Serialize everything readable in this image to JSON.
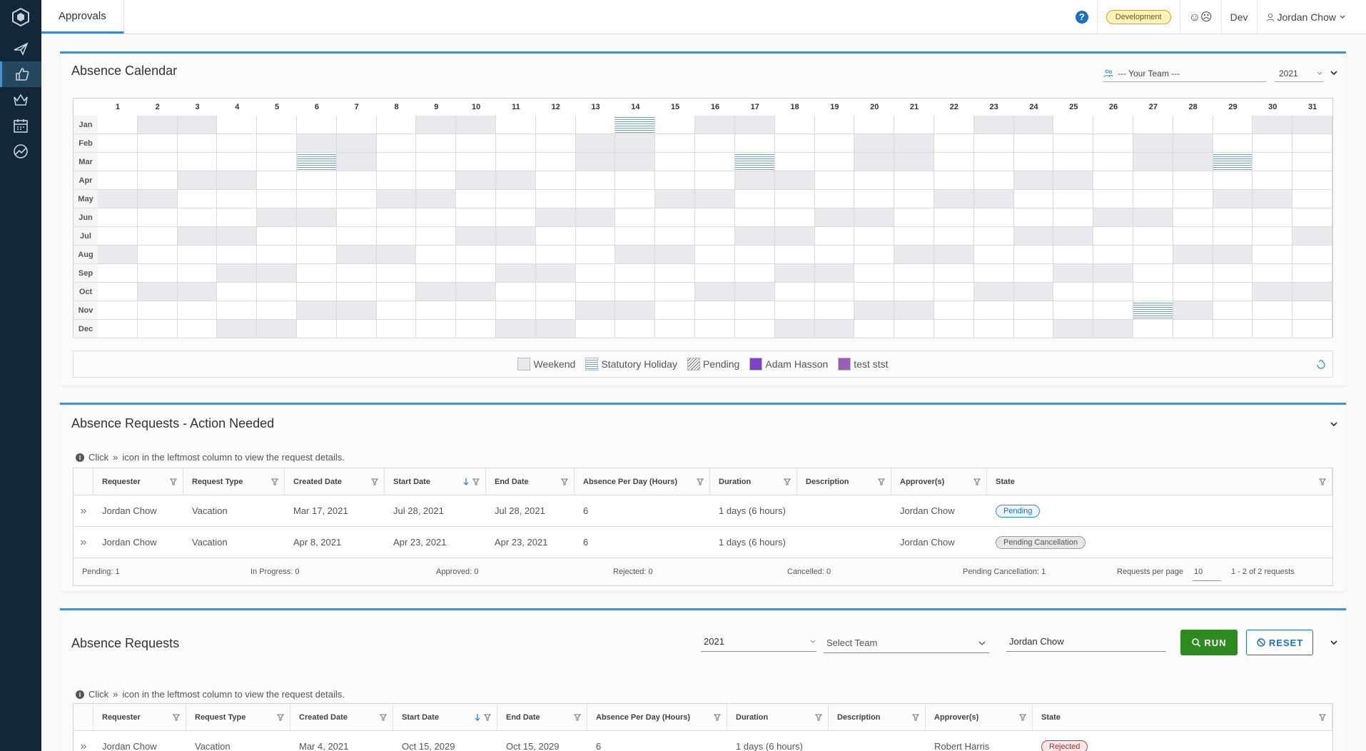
{
  "header": {
    "tab": "Approvals",
    "env_badge": "Development",
    "mood_icons": "☺☹",
    "env_short": "Dev",
    "user": "Jordan Chow"
  },
  "sidebar": {
    "items": [
      "logo-icon",
      "plane-icon",
      "thumbs-up-icon",
      "crown-icon",
      "calendar-icon",
      "chart-icon"
    ]
  },
  "calendar": {
    "title": "Absence Calendar",
    "team_select": "--- Your Team ---",
    "year_select": "2021",
    "days": [
      "1",
      "2",
      "3",
      "4",
      "5",
      "6",
      "7",
      "8",
      "9",
      "10",
      "11",
      "12",
      "13",
      "14",
      "15",
      "16",
      "17",
      "18",
      "19",
      "20",
      "21",
      "22",
      "23",
      "24",
      "25",
      "26",
      "27",
      "28",
      "29",
      "30",
      "31"
    ],
    "months": [
      "Jan",
      "Feb",
      "Mar",
      "Apr",
      "May",
      "Jun",
      "Jul",
      "Aug",
      "Sep",
      "Oct",
      "Nov",
      "Dec"
    ],
    "legend": {
      "weekend": "Weekend",
      "holiday": "Statutory Holiday",
      "pending": "Pending",
      "person1": "Adam Hasson",
      "person2": "test stst"
    },
    "colors": {
      "weekend": "#e9eaed",
      "holiday": "#6f9fd0",
      "person1": "#7a44c4",
      "person2": "#9a5fb5"
    }
  },
  "action_needed": {
    "title": "Absence Requests - Action Needed",
    "hint_pre": "Click",
    "hint_post": "icon in the leftmost column to view the request details.",
    "columns": [
      "Requester",
      "Request Type",
      "Created Date",
      "Start Date",
      "End Date",
      "Absence Per Day (Hours)",
      "Duration",
      "Description",
      "Approver(s)",
      "State"
    ],
    "rows": [
      {
        "requester": "Jordan Chow",
        "type": "Vacation",
        "created": "Mar 17, 2021",
        "start": "Jul 28, 2021",
        "end": "Jul 28, 2021",
        "hours": "6",
        "duration": "1 days (6 hours)",
        "description": "",
        "approver": "Jordan Chow",
        "state": "Pending"
      },
      {
        "requester": "Jordan Chow",
        "type": "Vacation",
        "created": "Apr 8, 2021",
        "start": "Apr 23, 2021",
        "end": "Apr 23, 2021",
        "hours": "6",
        "duration": "1 days (6 hours)",
        "description": "",
        "approver": "Jordan Chow",
        "state": "Pending Cancellation"
      }
    ],
    "footer": {
      "pending": "Pending: 1",
      "in_progress": "In Progress: 0",
      "approved": "Approved: 0",
      "rejected": "Rejected: 0",
      "cancelled": "Cancelled: 0",
      "pending_cancellation": "Pending Cancellation: 1",
      "per_page_label": "Requests per page",
      "per_page": "10",
      "range": "1 - 2 of 2 requests"
    }
  },
  "requests": {
    "title": "Absence Requests",
    "year": "2021",
    "team_placeholder": "Select Team",
    "user": "Jordan Chow",
    "run": "RUN",
    "reset": "RESET",
    "hint_pre": "Click",
    "hint_post": "icon in the leftmost column to view the request details.",
    "columns": [
      "Requester",
      "Request Type",
      "Created Date",
      "Start Date",
      "End Date",
      "Absence Per Day (Hours)",
      "Duration",
      "Description",
      "Approver(s)",
      "State"
    ],
    "rows": [
      {
        "requester": "Jordan Chow",
        "type": "Vacation",
        "created": "Mar 4, 2021",
        "start": "Oct 15, 2029",
        "end": "Oct 15, 2029",
        "hours": "6",
        "duration": "1 days (6 hours)",
        "description": "",
        "approver": "Robert Harris",
        "state": "Rejected"
      }
    ]
  }
}
